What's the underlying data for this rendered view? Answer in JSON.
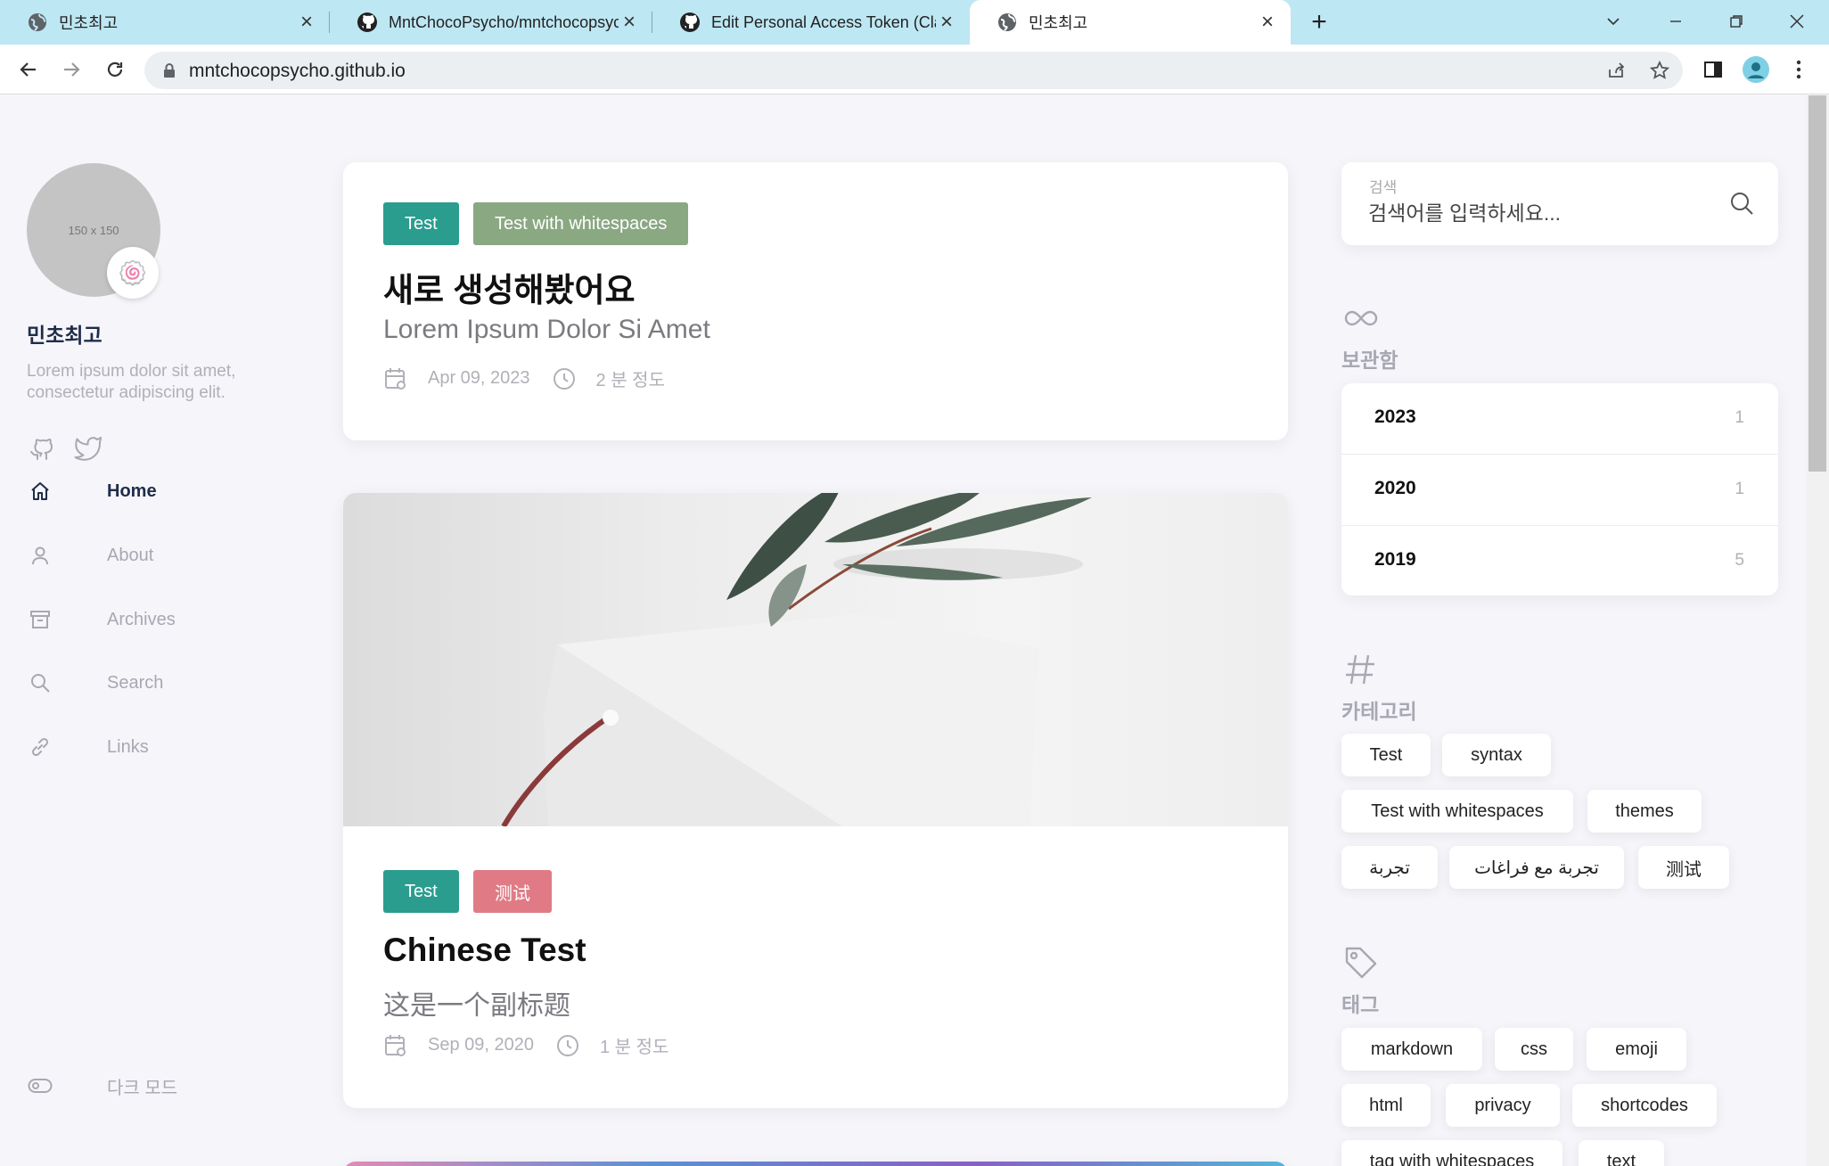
{
  "browser": {
    "tabs": [
      {
        "title": "민초최고",
        "active": false
      },
      {
        "title": "MntChocoPsycho/mntchocopsycho",
        "active": false
      },
      {
        "title": "Edit Personal Access Token (Classic)",
        "active": false
      },
      {
        "title": "민초최고",
        "active": true
      }
    ],
    "url": "mntchocopsycho.github.io"
  },
  "sidebar": {
    "avatar_placeholder": "150 x 150",
    "avatar_emoji": "🍥",
    "site_title": "민초최고",
    "site_description": "Lorem ipsum dolor sit amet, consectetur adipiscing elit.",
    "menu": [
      {
        "label": "Home",
        "icon": "home-icon",
        "active": true
      },
      {
        "label": "About",
        "icon": "user-icon",
        "active": false
      },
      {
        "label": "Archives",
        "icon": "archive-icon",
        "active": false
      },
      {
        "label": "Search",
        "icon": "search-icon",
        "active": false
      },
      {
        "label": "Links",
        "icon": "link-icon",
        "active": false
      }
    ],
    "dark_mode_label": "다크 모드"
  },
  "posts": [
    {
      "tags": [
        {
          "label": "Test",
          "color": "#2a9d8f"
        },
        {
          "label": "Test with whitespaces",
          "color": "#8aa882"
        }
      ],
      "title": "새로 생성해봤어요",
      "subtitle": "Lorem Ipsum Dolor Si Amet",
      "date": "Apr 09, 2023",
      "read_time": "2 분 정도"
    },
    {
      "tags": [
        {
          "label": "Test",
          "color": "#2a9d8f"
        },
        {
          "label": "测试",
          "color": "#e07b86"
        }
      ],
      "title": "Chinese Test",
      "subtitle": "这是一个副标题",
      "date": "Sep 09, 2020",
      "read_time": "1 분 정도"
    }
  ],
  "right": {
    "search": {
      "label": "검색",
      "placeholder": "검색어를 입력하세요..."
    },
    "archives": {
      "title": "보관함",
      "items": [
        {
          "year": "2023",
          "count": "1"
        },
        {
          "year": "2020",
          "count": "1"
        },
        {
          "year": "2019",
          "count": "5"
        }
      ]
    },
    "categories": {
      "title": "카테고리",
      "items": [
        "Test",
        "syntax",
        "Test with whitespaces",
        "themes",
        "تجربة",
        "تجربة مع فراغات",
        "测试"
      ]
    },
    "tags": {
      "title": "태그",
      "items": [
        "markdown",
        "css",
        "emoji",
        "html",
        "privacy",
        "shortcodes",
        "tag with whitespaces",
        "text"
      ]
    }
  }
}
